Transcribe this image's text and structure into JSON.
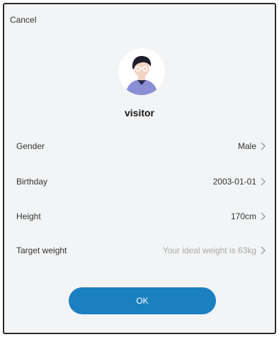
{
  "header": {
    "cancel_label": "Cancel"
  },
  "profile": {
    "avatar_icon": "user-avatar-icon",
    "name": "visitor"
  },
  "fields": [
    {
      "label": "Gender",
      "value": "Male"
    },
    {
      "label": "Birthday",
      "value": "2003-01-01"
    },
    {
      "label": "Height",
      "value": "170cm"
    },
    {
      "label": "Target weight",
      "value": "Your ideal weight is 63kg"
    }
  ],
  "footer": {
    "ok_label": "OK"
  },
  "colors": {
    "accent": "#1a80c0",
    "hint_text": "#a9a9a9",
    "background": "#f3f4f5"
  }
}
